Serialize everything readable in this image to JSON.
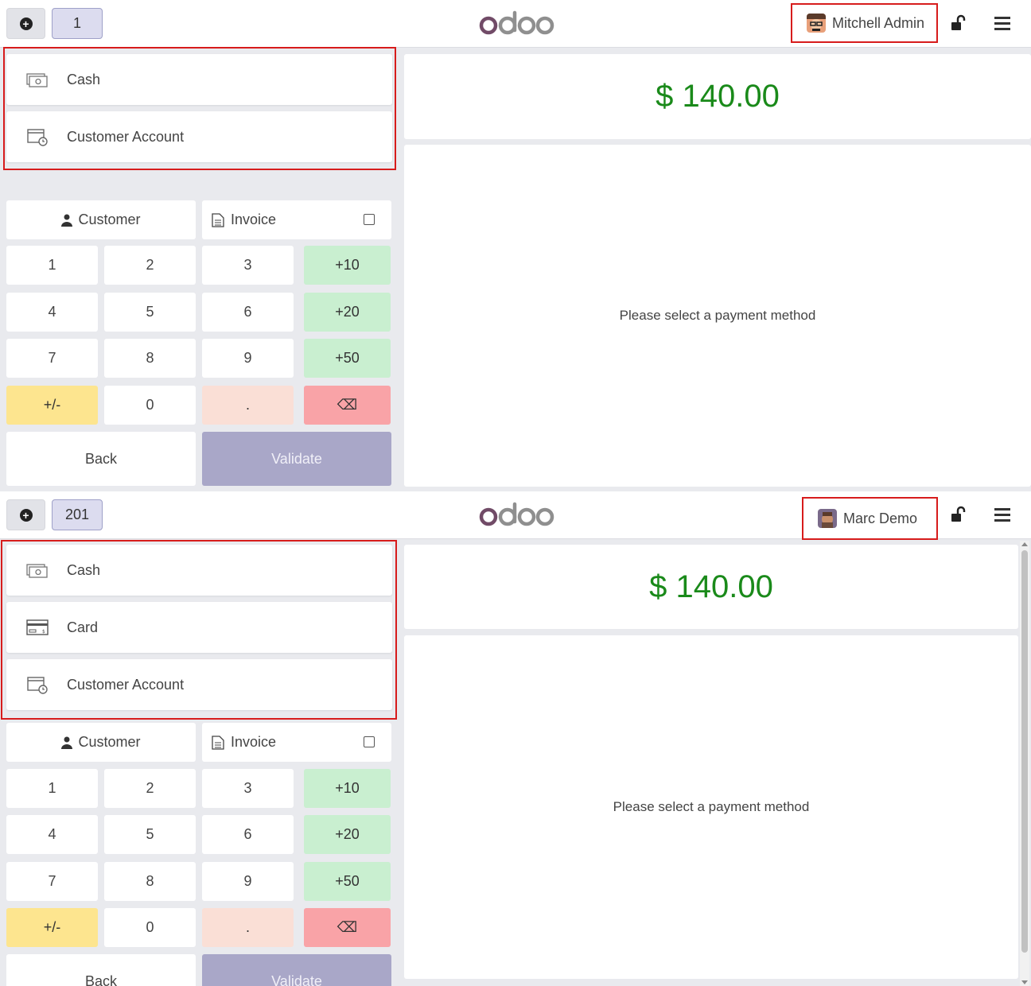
{
  "screen_a": {
    "order_number": "1",
    "user_name": "Mitchell Admin",
    "payment_methods": [
      {
        "label": "Cash",
        "icon": "cash-icon"
      },
      {
        "label": "Customer Account",
        "icon": "customer-account-icon"
      }
    ],
    "customer_label": "Customer",
    "invoice_label": "Invoice",
    "total": "$ 140.00",
    "status_message": "Please select a payment method",
    "back_label": "Back",
    "validate_label": "Validate"
  },
  "screen_b": {
    "order_number": "201",
    "user_name": "Marc Demo",
    "payment_methods": [
      {
        "label": "Cash",
        "icon": "cash-icon"
      },
      {
        "label": "Card",
        "icon": "card-icon"
      },
      {
        "label": "Customer Account",
        "icon": "customer-account-icon"
      }
    ],
    "customer_label": "Customer",
    "invoice_label": "Invoice",
    "total": "$ 140.00",
    "status_message": "Please select a payment method",
    "back_label": "Back",
    "validate_label": "Validate"
  },
  "keypad": {
    "k1": "1",
    "k2": "2",
    "k3": "3",
    "p10": "+10",
    "k4": "4",
    "k5": "5",
    "k6": "6",
    "p20": "+20",
    "k7": "7",
    "k8": "8",
    "k9": "9",
    "p50": "+50",
    "plusminus": "+/-",
    "k0": "0",
    "dot": ".",
    "backspace": "⌫"
  },
  "colors": {
    "total_green": "#1a8a1a",
    "highlight_red": "#d71c1c",
    "add_key_green": "#c9efd0",
    "sign_key_yellow": "#fde58f",
    "backspace_red": "#f9a3a7",
    "validate_purple": "#a9a7c8",
    "brand_purple": "#714b67"
  }
}
